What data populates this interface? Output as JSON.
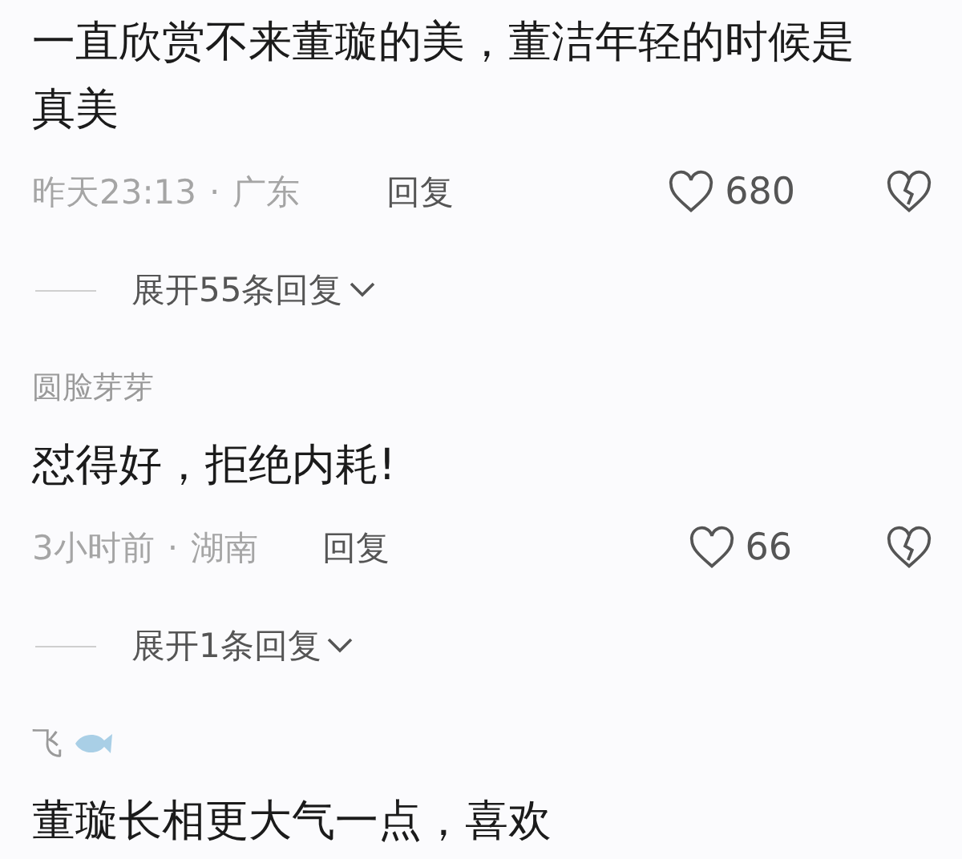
{
  "comments": [
    {
      "badge": false,
      "text": "一直欣赏不来董璇的美，董洁年轻的时候是真美",
      "time": "昨天23:13",
      "separator": "·",
      "location": "广东",
      "reply": "回复",
      "likes": "680",
      "expand": "展开55条回复"
    },
    {
      "username": "圆脸芽芽",
      "badge": false,
      "text": "怼得好，拒绝内耗!",
      "time": "3小时前",
      "separator": "·",
      "location": "湖南",
      "reply": "回复",
      "likes": "66",
      "expand": "展开1条回复"
    },
    {
      "username": "飞",
      "badge": true,
      "text": "董璇长相更大气一点，喜欢"
    }
  ]
}
